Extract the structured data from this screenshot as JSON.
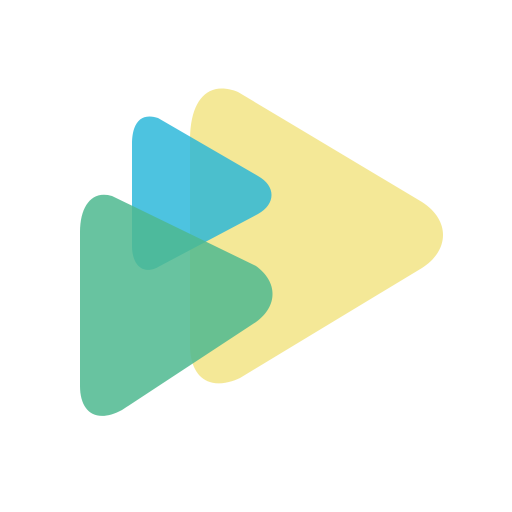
{
  "logo": {
    "name": "overlapping-play-triangles-logo",
    "colors": {
      "yellow": "#F3E68E",
      "blue": "#26B6D9",
      "green": "#4DB98F",
      "background": "#FFFFFF"
    }
  }
}
